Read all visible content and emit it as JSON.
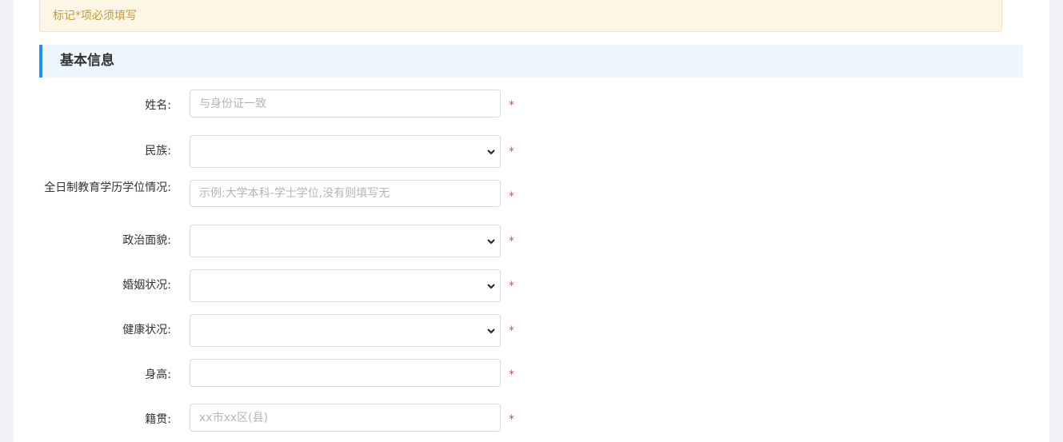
{
  "notice": {
    "text": "标记*项必须填写"
  },
  "section": {
    "title": "基本信息"
  },
  "required_mark": "*",
  "fields": [
    {
      "label": "姓名:",
      "type": "text",
      "placeholder": "与身份证一致",
      "value": ""
    },
    {
      "label": "民族:",
      "type": "select",
      "value": ""
    },
    {
      "label": "全日制教育学历学位情况:",
      "type": "text",
      "placeholder": "示例:大学本科-学士学位,没有则填写无",
      "value": ""
    },
    {
      "label": "政治面貌:",
      "type": "select",
      "value": ""
    },
    {
      "label": "婚姻状况:",
      "type": "select",
      "value": ""
    },
    {
      "label": "健康状况:",
      "type": "select",
      "value": ""
    },
    {
      "label": "身高:",
      "type": "text",
      "placeholder": "",
      "value": ""
    },
    {
      "label": "籍贯:",
      "type": "text",
      "placeholder": "xx市xx区(县)",
      "value": ""
    }
  ],
  "icons": {
    "select_arrow": "chevron-down-icon"
  }
}
